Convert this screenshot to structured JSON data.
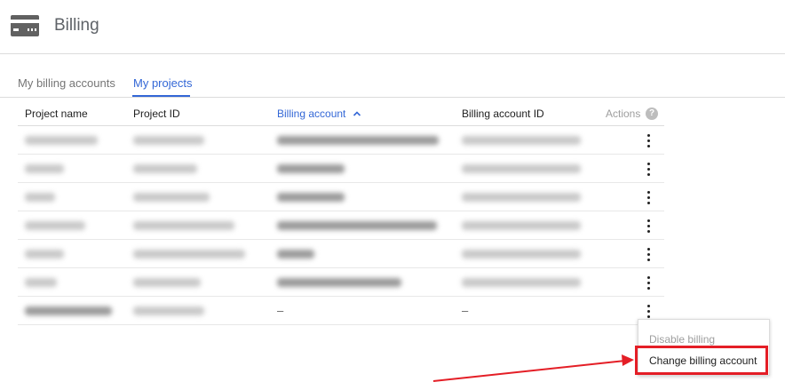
{
  "header": {
    "title": "Billing",
    "icon": "credit-card-icon"
  },
  "tabs": [
    {
      "label": "My billing accounts",
      "active": false
    },
    {
      "label": "My projects",
      "active": true
    }
  ],
  "table": {
    "columns": {
      "project_name": "Project name",
      "project_id": "Project ID",
      "billing_account": "Billing account",
      "billing_account_id": "Billing account ID",
      "actions": "Actions"
    },
    "sorted_column": "billing_account",
    "sort_direction": "ascending",
    "help_glyph": "?",
    "last_row": {
      "billing_account": "–",
      "billing_account_id": "–"
    }
  },
  "context_menu": {
    "items": [
      {
        "label": "Disable billing",
        "enabled": false
      },
      {
        "label": "Change billing account",
        "enabled": true,
        "highlighted": true
      }
    ]
  },
  "colors": {
    "accent": "#3367d6",
    "highlight": "#e41e26"
  }
}
